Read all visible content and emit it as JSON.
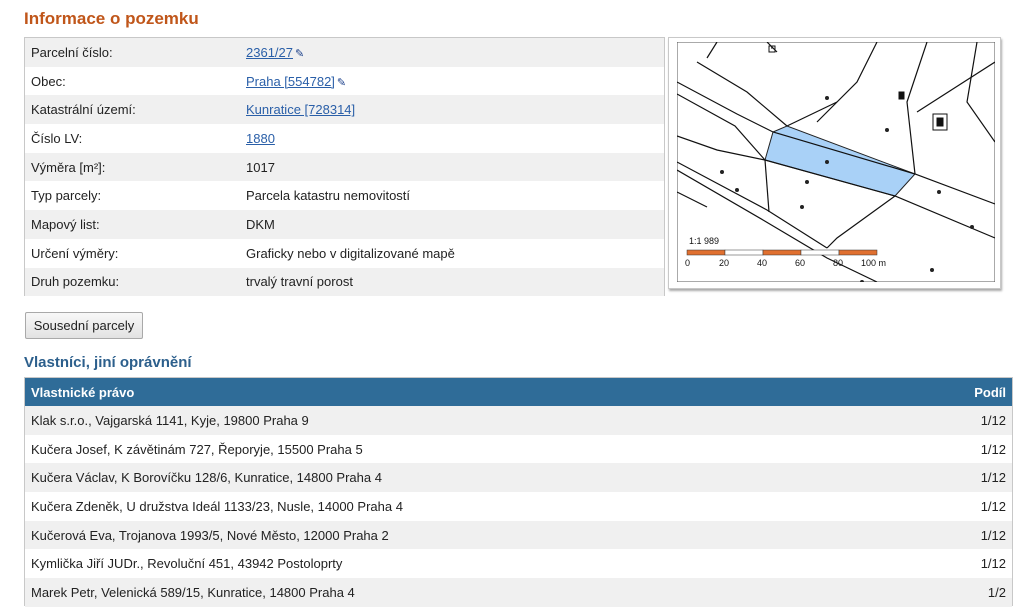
{
  "title": "Informace o pozemku",
  "parcel_info": [
    {
      "label": "Parcelní číslo:",
      "value": "2361/27",
      "link": true,
      "edit_icon": true
    },
    {
      "label": "Obec:",
      "value": "Praha [554782]",
      "link": true,
      "edit_icon": true
    },
    {
      "label": "Katastrální území:",
      "value": "Kunratice [728314]",
      "link": true,
      "edit_icon": false
    },
    {
      "label": "Číslo LV:",
      "value": "1880",
      "link": true,
      "edit_icon": false
    },
    {
      "label": "Výměra [m²]:",
      "value": "1017",
      "link": false,
      "edit_icon": false
    },
    {
      "label": "Typ parcely:",
      "value": "Parcela katastru nemovitostí",
      "link": false,
      "edit_icon": false
    },
    {
      "label": "Mapový list:",
      "value": "DKM",
      "link": false,
      "edit_icon": false
    },
    {
      "label": "Určení výměry:",
      "value": "Graficky nebo v digitalizované mapě",
      "link": false,
      "edit_icon": false
    },
    {
      "label": "Druh pozemku:",
      "value": "trvalý travní porost",
      "link": false,
      "edit_icon": false
    }
  ],
  "map": {
    "scale_label": "1:1 989",
    "scale_ticks": [
      "0",
      "20",
      "40",
      "60",
      "80",
      "100 m"
    ],
    "highlight_color": "#a9d1f7"
  },
  "neighbors_button": "Sousední parcely",
  "owners_section_title": "Vlastníci, jiní oprávnění",
  "owners_table": {
    "col_owner": "Vlastnické právo",
    "col_share": "Podíl",
    "rows": [
      {
        "owner": "Klak s.r.o., Vajgarská 1141, Kyje, 19800 Praha 9",
        "share": "1/12"
      },
      {
        "owner": "Kučera Josef, K závětinám 727, Řeporyje, 15500 Praha 5",
        "share": "1/12"
      },
      {
        "owner": "Kučera Václav, K Borovíčku 128/6, Kunratice, 14800 Praha 4",
        "share": "1/12"
      },
      {
        "owner": "Kučera Zdeněk, U družstva Ideál 1133/23, Nusle, 14000 Praha 4",
        "share": "1/12"
      },
      {
        "owner": "Kučerová Eva, Trojanova 1993/5, Nové Město, 12000 Praha 2",
        "share": "1/12"
      },
      {
        "owner": "Kymlička Jiří JUDr., Revoluční 451, 43942 Postoloprty",
        "share": "1/12"
      },
      {
        "owner": "Marek Petr, Velenická 589/15, Kunratice, 14800 Praha 4",
        "share": "1/2"
      }
    ]
  }
}
